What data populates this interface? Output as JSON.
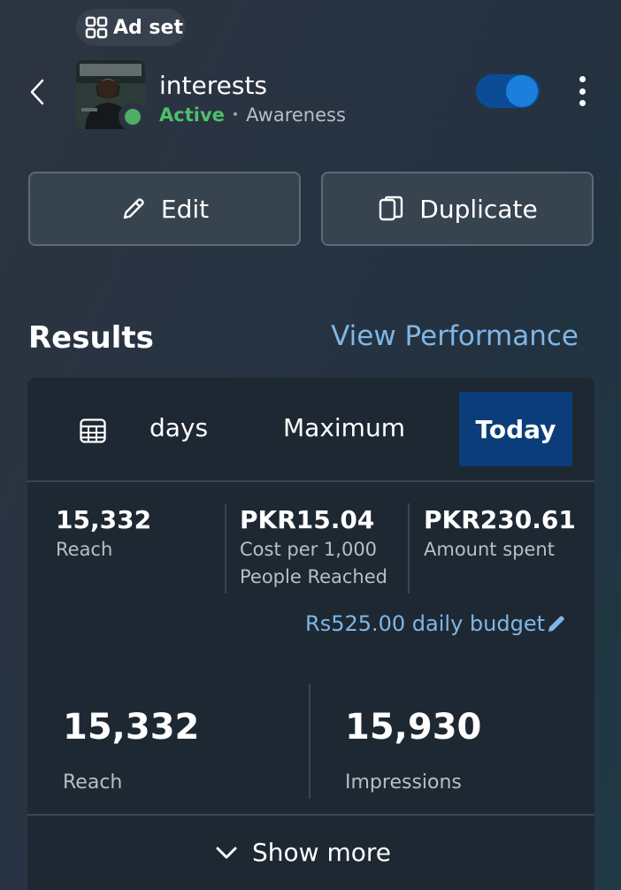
{
  "header": {
    "entity_type_label": "Ad set",
    "ad_set_name": "interests",
    "status": "Active",
    "separator": "•",
    "objective": "Awareness",
    "toggle_on": true,
    "icons": {
      "entity_type": "grid-icon",
      "back": "chevron-left-icon",
      "more": "more-vertical-icon"
    }
  },
  "actions": {
    "edit_label": "Edit",
    "duplicate_label": "Duplicate",
    "edit_icon": "pencil-icon",
    "duplicate_icon": "duplicate-icon"
  },
  "results": {
    "title": "Results",
    "view_performance_label": "View Performance",
    "tabs": [
      {
        "label": "days",
        "selected": false
      },
      {
        "label": "Maximum",
        "selected": false
      },
      {
        "label": "Today",
        "selected": true
      }
    ],
    "metrics": [
      {
        "value": "15,332",
        "label": "Reach"
      },
      {
        "value": "PKR15.04",
        "label_line1": "Cost per 1,000",
        "label_line2": "People Reached"
      },
      {
        "value": "PKR230.61",
        "label": "Amount spent"
      }
    ],
    "budget_label": "Rs525.00 daily budget",
    "highlights": [
      {
        "value": "15,332",
        "label": "Reach"
      },
      {
        "value": "15,930",
        "label": "Impressions"
      }
    ],
    "show_more_label": "Show more"
  },
  "colors": {
    "accent_link": "#7fb6e6",
    "active_green": "#4fbf6b",
    "toggle_track": "#0c4c96",
    "toggle_knob": "#1b7fdc",
    "selected_tab": "#0b3d7a",
    "card_bg": "#1e2833"
  }
}
